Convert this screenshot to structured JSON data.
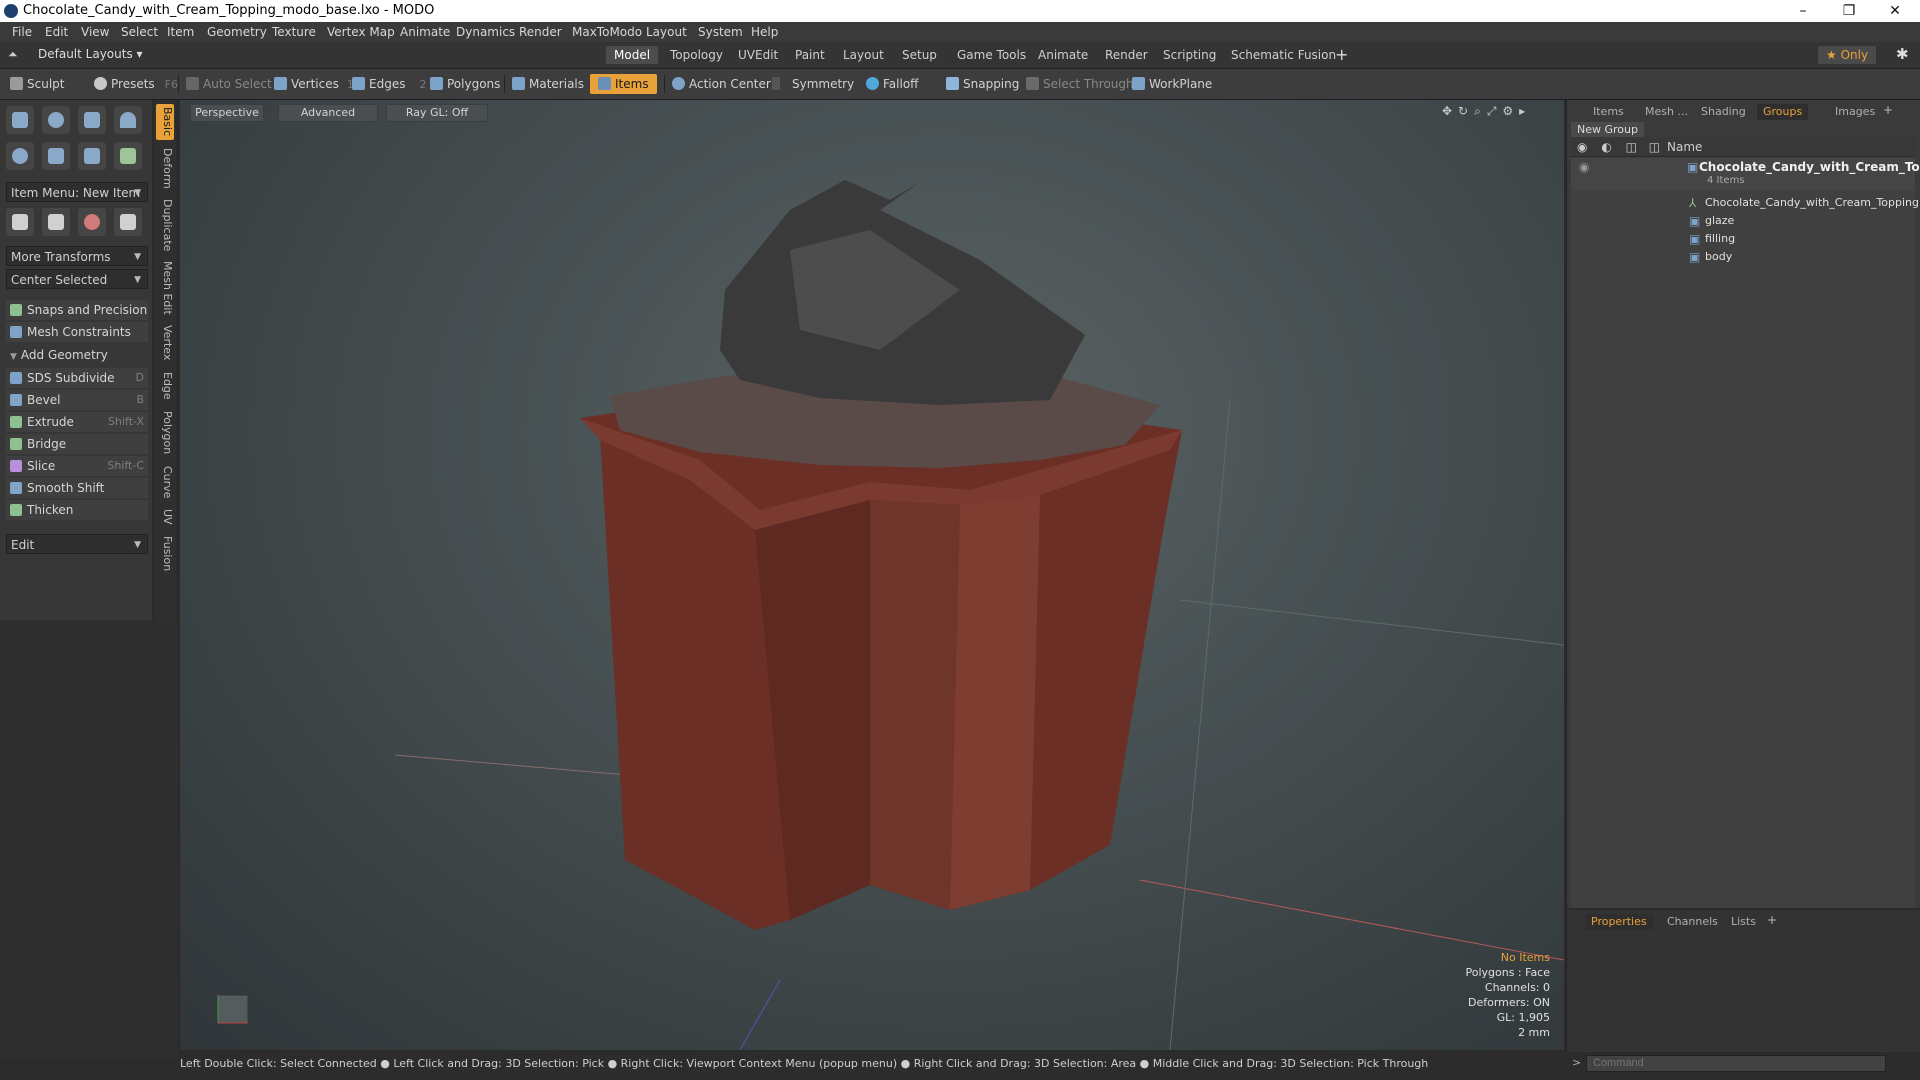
{
  "window": {
    "title": "Chocolate_Candy_with_Cream_Topping_modo_base.lxo - MODO",
    "minimize_glyph": "–",
    "restore_glyph": "❐",
    "close_glyph": "✕"
  },
  "menu": [
    "File",
    "Edit",
    "View",
    "Select",
    "Item",
    "Geometry",
    "Texture",
    "Vertex Map",
    "Animate",
    "Dynamics",
    "Render",
    "MaxToModo",
    "Layout",
    "System",
    "Help"
  ],
  "layout_bar": {
    "layout_name": "Default Layouts ▾",
    "tabs": [
      "Model",
      "Topology",
      "UVEdit",
      "Paint",
      "Layout",
      "Setup",
      "Game Tools",
      "Animate",
      "Render",
      "Scripting",
      "Schematic Fusion"
    ],
    "active_tab": "Model",
    "add_glyph": "+",
    "only_label": "★  Only",
    "gear_glyph": "✱"
  },
  "toolbar": {
    "sculpt": "Sculpt",
    "presets": "Presets",
    "presets_key": "F6",
    "auto_select": "Auto Select",
    "vertices": "Vertices",
    "vertices_key": "1",
    "edges": "Edges",
    "edges_key": "2",
    "polygons": "Polygons",
    "materials": "Materials",
    "items": "Items",
    "action_center": "Action Center",
    "symmetry": "Symmetry",
    "falloff": "Falloff",
    "snapping": "Snapping",
    "select_through": "Select Through",
    "workplane": "WorkPlane"
  },
  "left_panel": {
    "item_menu": "Item Menu: New Item",
    "more_transforms": "More Transforms",
    "center_selected": "Center Selected",
    "snaps": "Snaps and Precision",
    "mesh_constraints": "Mesh Constraints",
    "add_geometry": "Add Geometry",
    "tools": [
      {
        "label": "SDS Subdivide",
        "key": "D"
      },
      {
        "label": "Bevel",
        "key": "B"
      },
      {
        "label": "Extrude",
        "key": "Shift-X"
      },
      {
        "label": "Bridge",
        "key": ""
      },
      {
        "label": "Slice",
        "key": "Shift-C"
      },
      {
        "label": "Smooth Shift",
        "key": ""
      },
      {
        "label": "Thicken",
        "key": ""
      }
    ],
    "edit_dropdown": "Edit",
    "vertical_tabs": [
      "Basic",
      "Deform",
      "Duplicate",
      "Mesh Edit",
      "Vertex",
      "Edge",
      "Polygon",
      "Curve",
      "UV",
      "Fusion"
    ]
  },
  "viewport": {
    "view_mode": "Perspective",
    "shading": "Advanced",
    "raygl": "Ray GL: Off",
    "info": {
      "selection": "No Items",
      "polygons": "Polygons : Face",
      "channels": "Channels: 0",
      "deformers": "Deformers: ON",
      "gl": "GL: 1,905",
      "scale": "2 mm"
    }
  },
  "right_panel": {
    "tabs": [
      "Items",
      "Mesh ...",
      "Shading",
      "Groups",
      "Images"
    ],
    "active_tab": "Groups",
    "new_group": "New Group",
    "name_header": "Name",
    "tree": {
      "root": "Chocolate_Candy_with_Cream_To...",
      "root_count": "4 Items",
      "children": [
        "Chocolate_Candy_with_Cream_Topping",
        "glaze",
        "filling",
        "body"
      ]
    },
    "bottom_tabs": [
      "Properties",
      "Channels",
      "Lists"
    ],
    "bottom_active": "Properties"
  },
  "status_bar": {
    "hints": "Left Double Click: Select Connected ● Left Click and Drag: 3D Selection: Pick ● Right Click: Viewport Context Menu (popup menu) ● Right Click and Drag: 3D Selection: Area ● Middle Click and Drag: 3D Selection: Pick Through"
  },
  "command": {
    "placeholder": "Command"
  },
  "colors": {
    "accent": "#e9a13a",
    "body_brown": "#6b2f26",
    "topping_dark": "#3a3a3a"
  }
}
